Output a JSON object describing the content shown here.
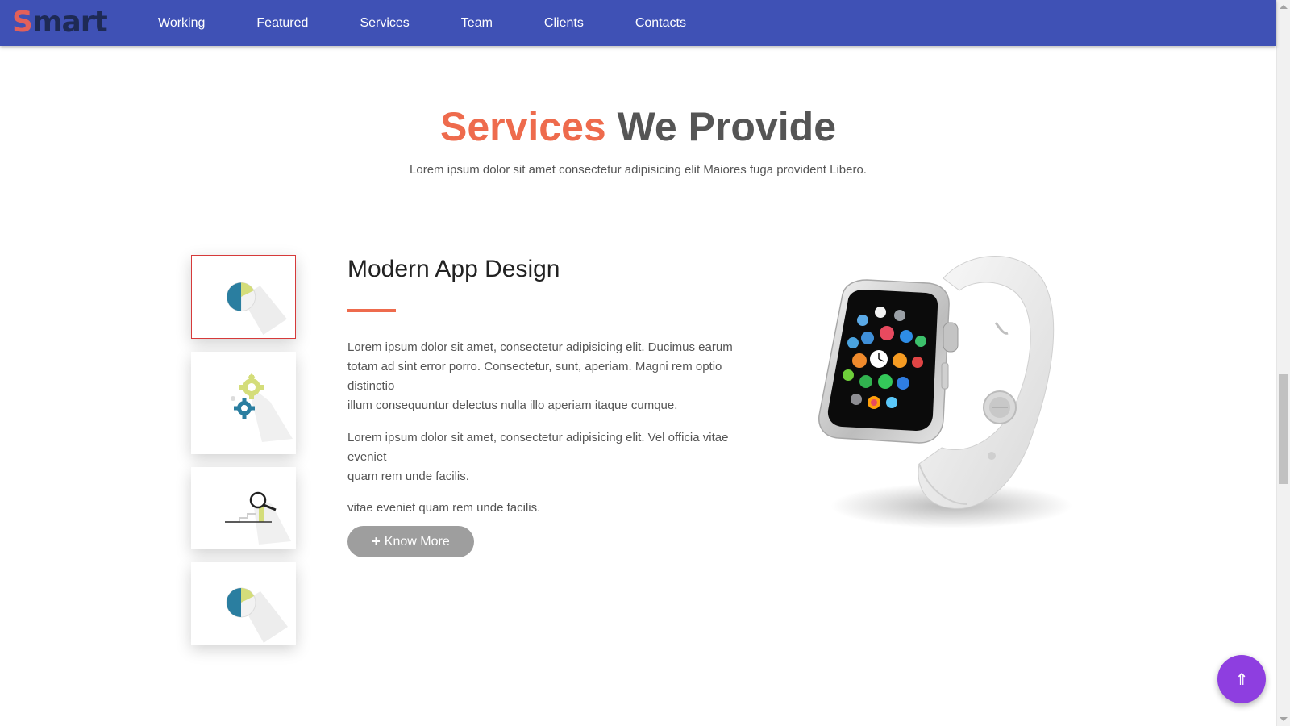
{
  "brand": {
    "letter": "S",
    "rest": "mart"
  },
  "nav": {
    "items": [
      "Working",
      "Featured",
      "Services",
      "Team",
      "Clients",
      "Contacts"
    ]
  },
  "section": {
    "title_highlight": "Services",
    "title_rest": "We Provide",
    "subtitle": "Lorem ipsum dolor sit amet consectetur adipisicing elit Maiores fuga provident Libero."
  },
  "tabs": [
    {
      "icon": "pie-chart-icon",
      "active": true
    },
    {
      "icon": "gears-icon",
      "active": false
    },
    {
      "icon": "magnifier-stairs-icon",
      "active": false
    },
    {
      "icon": "pie-chart-icon",
      "active": false
    }
  ],
  "content": {
    "title": "Modern App Design",
    "paragraph1_line1": "Lorem ipsum dolor sit amet, consectetur adipisicing elit. Ducimus earum",
    "paragraph1_line2": "totam ad sint error porro. Consectetur, sunt, aperiam. Magni rem optio",
    "paragraph1_line3": "distinctio",
    "paragraph1_line4": "illum consequuntur delectus nulla illo aperiam itaque cumque.",
    "paragraph2_line1": "Lorem ipsum dolor sit amet, consectetur adipisicing elit. Vel officia vitae",
    "paragraph2_line2": "eveniet",
    "paragraph2_line3": "quam rem unde facilis.",
    "paragraph3": "vitae eveniet quam rem unde facilis.",
    "button_label": "Know More",
    "button_icon": "plus-icon"
  },
  "image": {
    "subject": "smartwatch"
  },
  "fab": {
    "icon": "arrow-up-icon",
    "glyph": "⇑"
  },
  "colors": {
    "navbar": "#3f51b5",
    "accent": "#ee6b4d",
    "brand_letter": "#e2605a",
    "fab": "#8e3ee0",
    "button": "#9e9e9e"
  }
}
